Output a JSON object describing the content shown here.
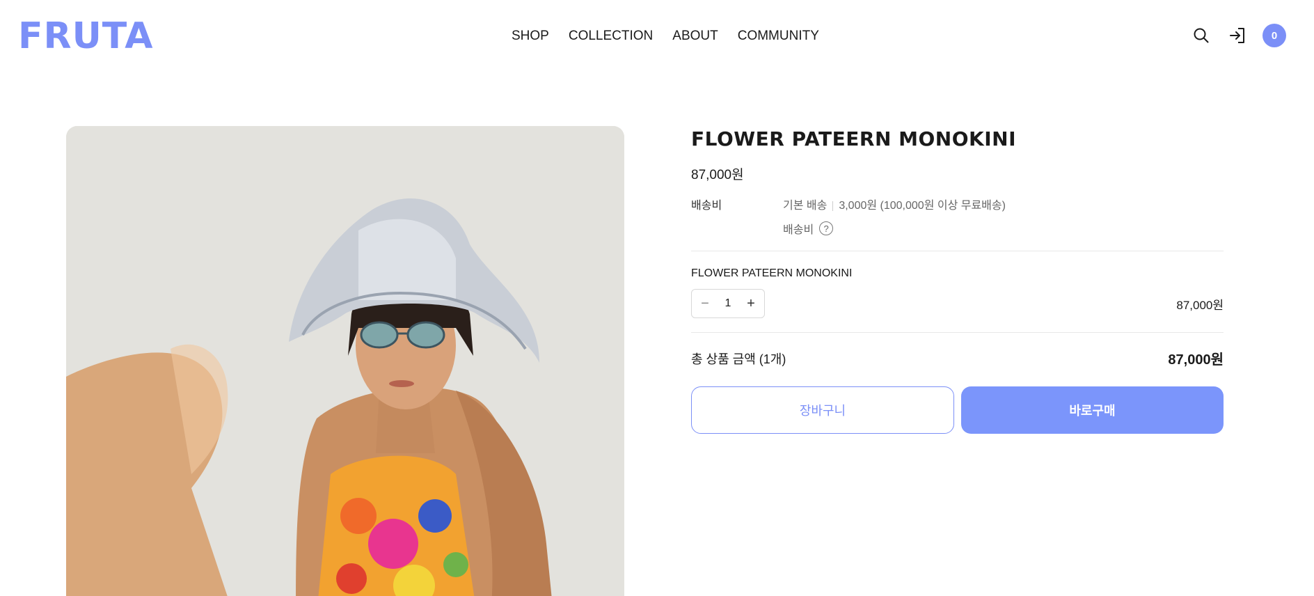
{
  "header": {
    "logo": "FRUTA",
    "nav": [
      "SHOP",
      "COLLECTION",
      "ABOUT",
      "COMMUNITY"
    ],
    "cart_count": "0",
    "icons": [
      "search-icon",
      "login-icon",
      "cart-badge"
    ]
  },
  "product": {
    "title": "FLOWER PATEERN MONOKINI",
    "price": "87,000원",
    "shipping": {
      "label": "배송비",
      "type": "기본 배송",
      "detail": "3,000원 (100,000원 이상 무료배송)",
      "sub_label": "배송비",
      "help": "?"
    },
    "option": {
      "name": "FLOWER PATEERN MONOKINI",
      "minus": "−",
      "plus": "+",
      "quantity": "1",
      "line_price": "87,000원"
    },
    "total": {
      "label": "총 상품 금액 (1개)",
      "price": "87,000원"
    },
    "buttons": {
      "cart": "장바구니",
      "buy": "바로구매"
    }
  },
  "colors": {
    "brand": "#7b8ff7",
    "buy_button": "#7b95fb"
  }
}
